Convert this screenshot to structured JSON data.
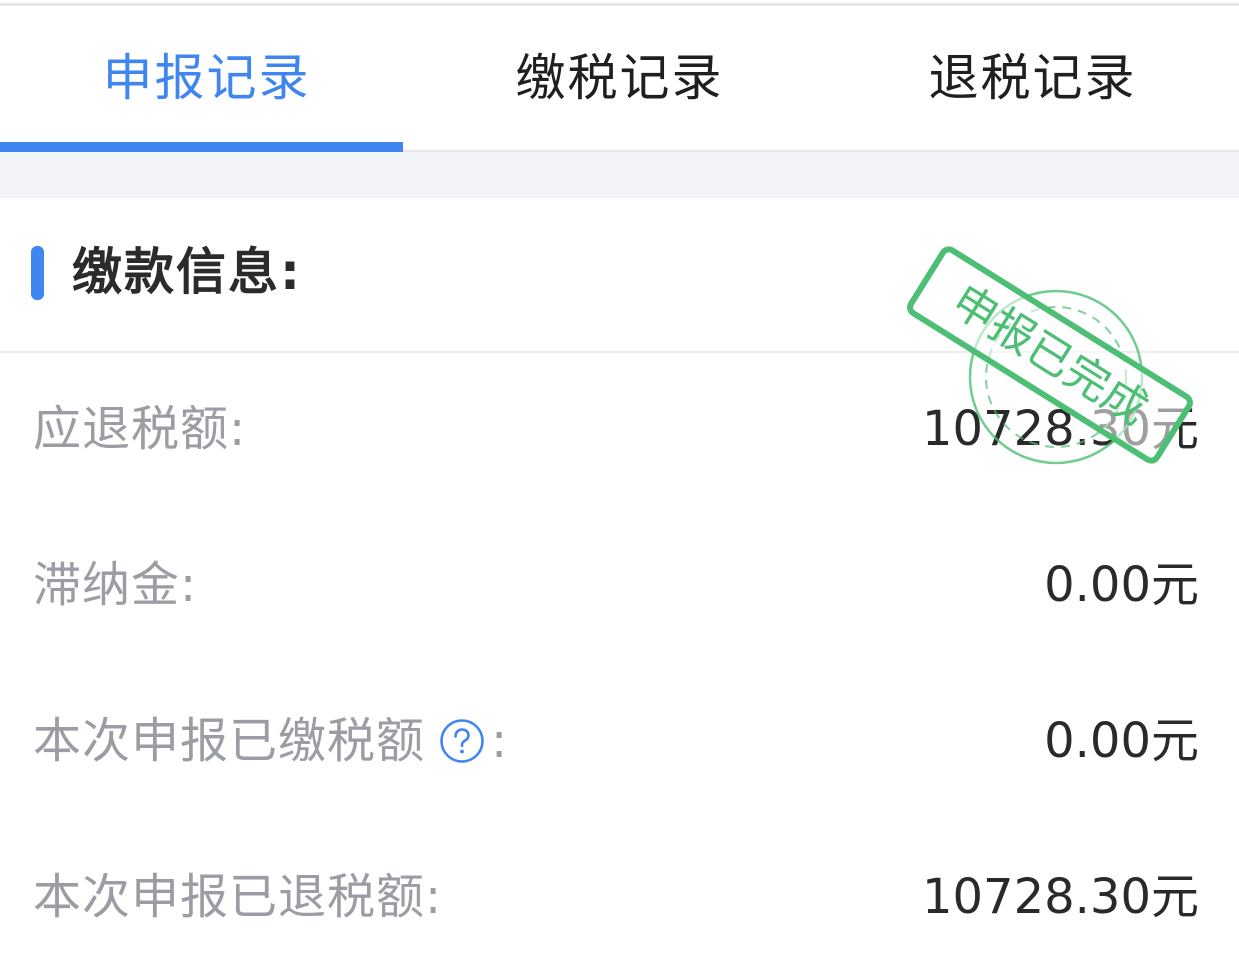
{
  "tabs": [
    {
      "label": "申报记录",
      "active": true
    },
    {
      "label": "缴税记录",
      "active": false
    },
    {
      "label": "退税记录",
      "active": false
    }
  ],
  "section": {
    "title": "缴款信息:"
  },
  "rows": [
    {
      "label": "应退税额:",
      "value": "10728.30元"
    },
    {
      "label": "滞纳金:",
      "value": "0.00元"
    },
    {
      "label": "本次申报已缴税额",
      "suffix": ":",
      "value": "0.00元",
      "help_icon": "question-circle-icon"
    },
    {
      "label": "本次申报已退税额:",
      "value": "10728.30元"
    }
  ],
  "stamp": {
    "text": "申报已完成",
    "color": "#4cbf74"
  },
  "colors": {
    "accent": "#3f86f0",
    "label": "#9a9da3",
    "value": "#2a2a2a",
    "stamp": "#4cbf74"
  }
}
